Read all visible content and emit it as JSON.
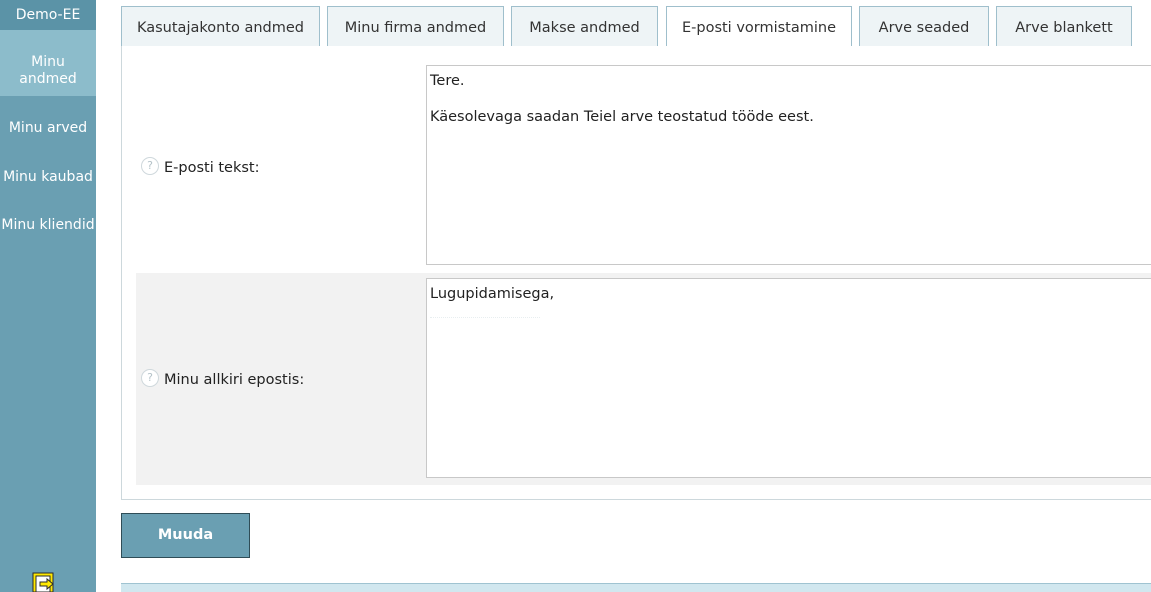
{
  "sidebar": {
    "brand": "Demo-EE",
    "items": [
      {
        "label": "Minu andmed",
        "active": true
      },
      {
        "label": "Minu arved"
      },
      {
        "label": "Minu kaubad"
      },
      {
        "label": "Minu kliendid"
      }
    ],
    "logout_icon": "exit-icon",
    "colors": {
      "background": "#6a9fb2",
      "active": "#8cbccb"
    }
  },
  "tabs": [
    {
      "label": "Kasutajakonto andmed"
    },
    {
      "label": "Minu firma andmed"
    },
    {
      "label": "Makse andmed"
    },
    {
      "label": "E-posti vormistamine",
      "active": true
    },
    {
      "label": "Arve seaded"
    },
    {
      "label": "Arve blankett"
    }
  ],
  "form": {
    "email_text": {
      "label": "E-posti tekst:",
      "help_icon": "question-icon",
      "lines": [
        "Tere.",
        "",
        "Käesolevaga saadan Teiel arve teostatud tööde eest."
      ]
    },
    "signature": {
      "label": "Minu allkiri epostis:",
      "help_icon": "question-icon",
      "lines": [
        "Lugupidamisega,"
      ]
    }
  },
  "actions": {
    "submit_label": "Muuda"
  }
}
